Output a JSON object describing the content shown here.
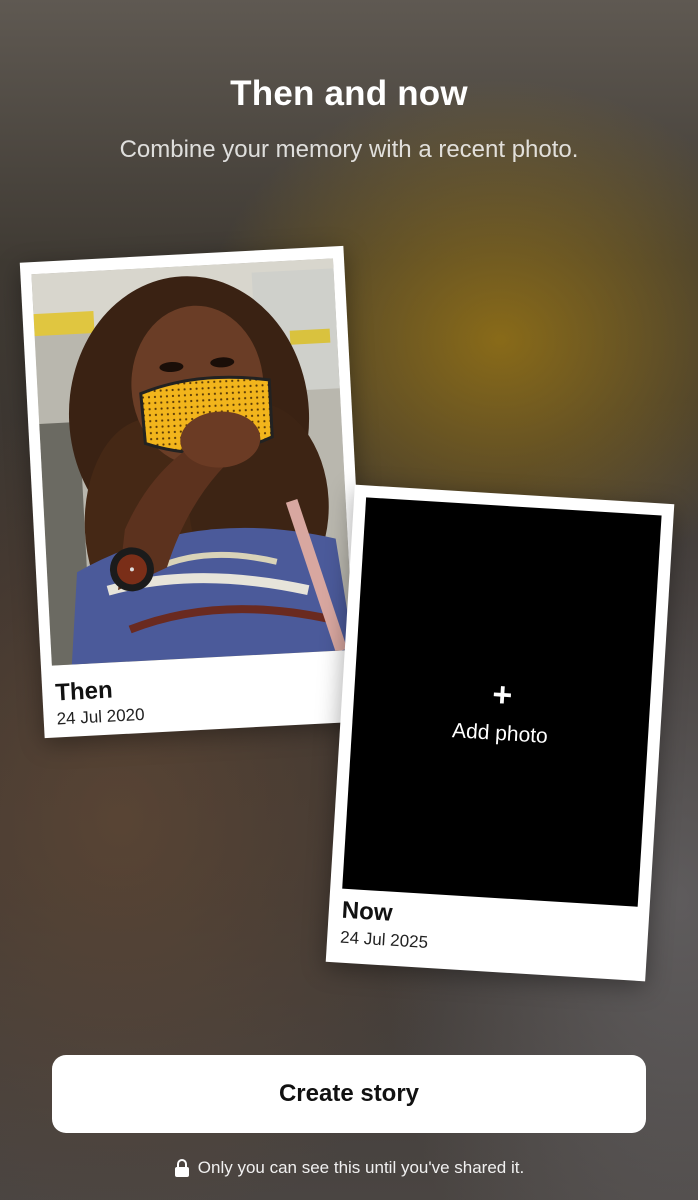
{
  "header": {
    "title": "Then and now",
    "subtitle": "Combine your memory with a recent photo."
  },
  "then_card": {
    "label": "Then",
    "date": "24 Jul 2020"
  },
  "now_card": {
    "label": "Now",
    "date": "24 Jul 2025",
    "add_icon": "+",
    "add_label": "Add photo"
  },
  "actions": {
    "create_label": "Create story"
  },
  "footer": {
    "privacy_note": "Only you can see this until you've shared it.",
    "privacy_icon": "lock-icon"
  },
  "colors": {
    "button_bg": "#ffffff",
    "card_bg": "#ffffff",
    "placeholder_bg": "#000000"
  }
}
